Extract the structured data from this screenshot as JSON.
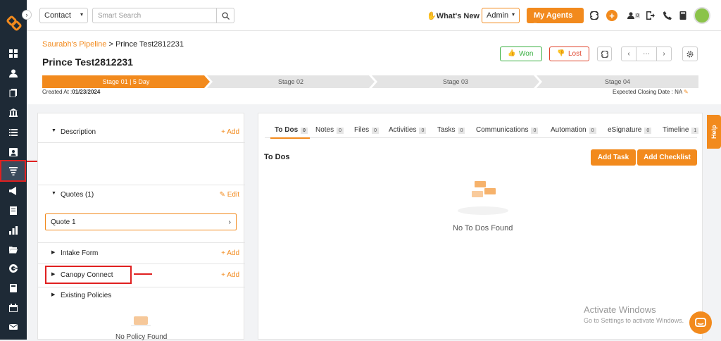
{
  "topbar": {
    "contact_select": "Contact",
    "search_placeholder": "Smart Search",
    "whats_new": "What's New",
    "admin_select": "Admin",
    "my_agents": "My Agents",
    "notif_count": "0"
  },
  "header": {
    "breadcrumb_parent": "Saurabh's Pipeline",
    "breadcrumb_sep": ">",
    "breadcrumb_current": "Prince Test2812231",
    "title": "Prince Test2812231",
    "won_label": "Won",
    "lost_label": "Lost",
    "more_label": "···"
  },
  "stages": [
    {
      "label": "Stage 01 | 5 Day"
    },
    {
      "label": "Stage 02"
    },
    {
      "label": "Stage 03"
    },
    {
      "label": "Stage 04"
    }
  ],
  "meta": {
    "created_label": "Created At :",
    "created_value": "01/23/2024",
    "closing_label": "Expected Closing Date :",
    "closing_value": "NA"
  },
  "left_panel": {
    "description": {
      "label": "Description",
      "action": "+ Add"
    },
    "quotes": {
      "label": "Quotes (1)",
      "action": "Edit",
      "item": "Quote 1"
    },
    "intake": {
      "label": "Intake Form",
      "action": "+ Add"
    },
    "canopy": {
      "label": "Canopy Connect",
      "action": "+ Add"
    },
    "policies": {
      "label": "Existing Policies",
      "empty": "No Policy Found"
    }
  },
  "tabs": [
    {
      "label": "To Dos",
      "count": "0"
    },
    {
      "label": "Notes",
      "count": "0"
    },
    {
      "label": "Files",
      "count": "0"
    },
    {
      "label": "Activities",
      "count": "0"
    },
    {
      "label": "Tasks",
      "count": "0"
    },
    {
      "label": "Communications",
      "count": "0"
    },
    {
      "label": "Automation",
      "count": "0"
    },
    {
      "label": "eSignature",
      "count": "0"
    },
    {
      "label": "Timeline",
      "count": "1"
    }
  ],
  "todos": {
    "heading": "To Dos",
    "add_task": "Add Task",
    "add_checklist": "Add Checklist",
    "empty": "No To Dos Found"
  },
  "help_label": "Help",
  "watermark": {
    "line1": "Activate Windows",
    "line2": "Go to Settings to activate Windows."
  },
  "colors": {
    "accent": "#f28a1d",
    "sidebar": "#1e2a36",
    "won": "#3cb043",
    "lost": "#e0452d"
  }
}
